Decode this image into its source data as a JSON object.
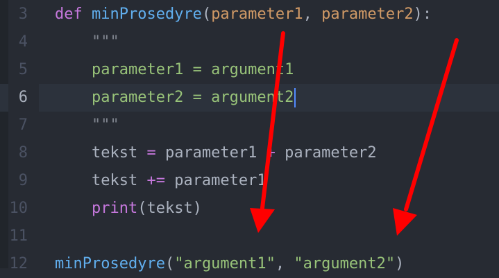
{
  "editor": {
    "theme_colors": {
      "background": "#272b33",
      "keyword": "#c678dd",
      "function": "#61afef",
      "parameter": "#d19a66",
      "string": "#98c379",
      "text": "#abb2bf",
      "annotation_arrow": "#ff0000"
    },
    "active_line": "6",
    "lines": [
      {
        "num": "3",
        "tokens": [
          {
            "t": "def ",
            "c": "kw"
          },
          {
            "t": "minProsedyre",
            "c": "fn"
          },
          {
            "t": "(",
            "c": "plain"
          },
          {
            "t": "parameter1",
            "c": "param"
          },
          {
            "t": ", ",
            "c": "plain"
          },
          {
            "t": "parameter2",
            "c": "param"
          },
          {
            "t": "):",
            "c": "plain"
          }
        ]
      },
      {
        "num": "4",
        "tokens": [
          {
            "t": "    \"\"\"",
            "c": "doc"
          }
        ]
      },
      {
        "num": "5",
        "tokens": [
          {
            "t": "    parameter1 = argument1",
            "c": "str"
          }
        ]
      },
      {
        "num": "6",
        "tokens": [
          {
            "t": "    parameter2 = argument2",
            "c": "str"
          }
        ]
      },
      {
        "num": "7",
        "tokens": [
          {
            "t": "    \"\"\"",
            "c": "doc"
          }
        ]
      },
      {
        "num": "8",
        "tokens": [
          {
            "t": "    tekst ",
            "c": "plain"
          },
          {
            "t": "=",
            "c": "op"
          },
          {
            "t": " parameter1 ",
            "c": "plain"
          },
          {
            "t": "+",
            "c": "op"
          },
          {
            "t": " parameter2",
            "c": "plain"
          }
        ]
      },
      {
        "num": "9",
        "tokens": [
          {
            "t": "    tekst ",
            "c": "plain"
          },
          {
            "t": "+=",
            "c": "op"
          },
          {
            "t": " parameter1",
            "c": "plain"
          }
        ]
      },
      {
        "num": "10",
        "tokens": [
          {
            "t": "    ",
            "c": "plain"
          },
          {
            "t": "print",
            "c": "kw"
          },
          {
            "t": "(tekst)",
            "c": "plain"
          }
        ]
      },
      {
        "num": "11",
        "tokens": []
      },
      {
        "num": "12",
        "tokens": [
          {
            "t": "minProsedyre",
            "c": "fn"
          },
          {
            "t": "(",
            "c": "plain"
          },
          {
            "t": "\"argument1\"",
            "c": "str"
          },
          {
            "t": ", ",
            "c": "plain"
          },
          {
            "t": "\"argument2\"",
            "c": "str"
          },
          {
            "t": ")",
            "c": "plain"
          }
        ]
      }
    ]
  }
}
